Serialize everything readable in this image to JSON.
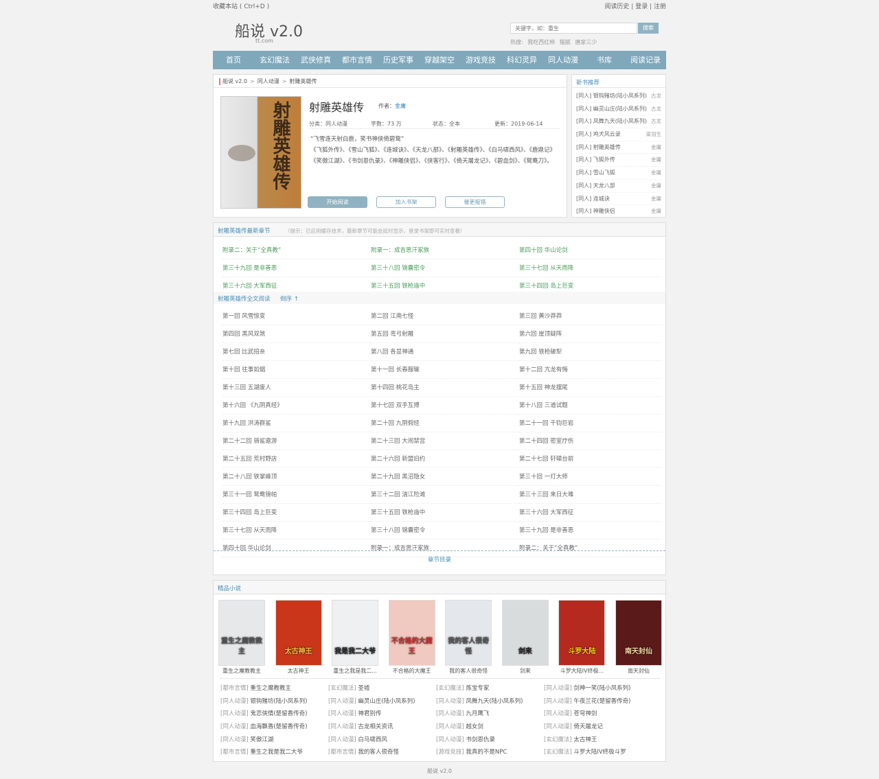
{
  "topbar": {
    "bookmark": "收藏本站 ( Ctrl+D )",
    "history": "阅读历史",
    "login": "登录",
    "register": "注册",
    "sep": " | "
  },
  "header": {
    "logo": "船说 v2.0",
    "logo_sub": "tt.com",
    "search_placeholder": "关键字，如：重生",
    "search_button": "搜索",
    "hot_label": "热搜:",
    "hot_items": [
      "我吃西红柿",
      "猫腻",
      "唐家三少"
    ]
  },
  "nav": [
    "首页",
    "玄幻魔法",
    "武侠修真",
    "都市言情",
    "历史军事",
    "穿越架空",
    "游戏竞技",
    "科幻灵异",
    "同人动漫",
    "书库",
    "阅读记录"
  ],
  "breadcrumb": [
    "船说 v2.0",
    ">",
    "同人动漫",
    ">",
    "射雕英雄传"
  ],
  "book": {
    "title": "射雕英雄传",
    "author_label": "作者：",
    "author": "金庸",
    "category": "分类：同人动漫",
    "words": "字数：73 万",
    "status": "状态：全本",
    "updated": "更新：2019-06-14",
    "desc": [
      "“飞雪连天射白鹿，笑书神侠倚碧鸳”",
      "《飞狐外传》、《雪山飞狐》、《连城诀》、《天龙八部》、《射雕英雄传》、《白马啸西风》、《鹿鼎记》",
      "《笑傲江湖》、《书剑恩仇录》、《神雕侠侣》、《侠客行》、《倚天屠龙记》、《碧血剑》、《鸳鸯刀》。"
    ],
    "btn_read": "开始阅读",
    "btn_shelf": "加入书架",
    "btn_vote": "催更报错",
    "cover_text": "射雕英雄传"
  },
  "recommend": {
    "title": "新书推荐",
    "items": [
      {
        "name": "[同人] 银钩赌坊(陆小凤系列)",
        "author": "古龙"
      },
      {
        "name": "[同人] 幽灵山庄(陆小凤系列)",
        "author": "古龙"
      },
      {
        "name": "[同人] 凤舞九天(陆小凤系列)",
        "author": "古龙"
      },
      {
        "name": "[同人] 鸡犬风云录",
        "author": "梁羽生"
      },
      {
        "name": "[同人] 射雕英雄传",
        "author": "金庸"
      },
      {
        "name": "[同人] 飞狐外传",
        "author": "金庸"
      },
      {
        "name": "[同人] 雪山飞狐",
        "author": "金庸"
      },
      {
        "name": "[同人] 天龙八部",
        "author": "金庸"
      },
      {
        "name": "[同人] 连城诀",
        "author": "金庸"
      },
      {
        "name": "[同人] 神雕侠侣",
        "author": "金庸"
      }
    ]
  },
  "latest": {
    "title": "射雕英雄传最新章节",
    "tip": "（提示：已启用缓存技术，最新章节可能会延时显示，登录书架即可实时查看）",
    "chapters": [
      "附录二：关于“全真教”",
      "附录一：成吉思汗家族",
      "第四十回 华山论剑",
      "第三十九回 是非善恶",
      "第三十八回 锦囊密令",
      "第三十七回 从天而降",
      "第三十六回 大军西征",
      "第三十五回 铁枪庙中",
      "第三十四回 岛上巨变"
    ]
  },
  "full": {
    "title": "射雕英雄传全文阅读",
    "order": "倒序 ↑",
    "chapters": [
      "第一回 风雪惊变",
      "第二回 江南七怪",
      "第三回 黄沙莽莽",
      "第四回 黑风双煞",
      "第五回 弯弓射雕",
      "第六回 崖顶疑阵",
      "第七回 比武招亲",
      "第八回 各显神通",
      "第九回 铁枪破犁",
      "第十回 往事如烟",
      "第十一回 长春服输",
      "第十二回 亢龙有悔",
      "第十三回 五湖废人",
      "第十四回 桃花岛主",
      "第十五回 神龙摆尾",
      "第十六回 《九阴真经》",
      "第十七回 双手互搏",
      "第十八回 三道试题",
      "第十九回 洪涛群鲨",
      "第二十回 九阴假经",
      "第二十一回 千钧巨岩",
      "第二十二回 骑鲨遨游",
      "第二十三回 大闹禁宫",
      "第二十四回 密室疗伤",
      "第二十五回 荒村野店",
      "第二十六回 新盟旧约",
      "第二十七回 轩辕台前",
      "第二十八回 铁掌峰顶",
      "第二十九回 黑沼隐女",
      "第三十回 一灯大师",
      "第三十一回 鸳鸯锦帕",
      "第三十二回 湍江险滩",
      "第三十三回 来日大难",
      "第三十四回 岛上巨变",
      "第三十五回 铁枪庙中",
      "第三十六回 大军西征",
      "第三十七回 从天而降",
      "第三十八回 锦囊密令",
      "第三十九回 是非善恶",
      "第四十回 华山论剑",
      "附录一：成吉思汗家族",
      "附录二：关于“全真教”"
    ],
    "dir_link": "章节目录"
  },
  "featured": {
    "title": "精品小说",
    "books": [
      {
        "name": "重生之魔教教主",
        "cover": "重生之魔教教主",
        "bg": "#e6e8ea",
        "fg": "#555"
      },
      {
        "name": "太古神王",
        "cover": "太古神王",
        "bg": "#c9361a",
        "fg": "#f5c542"
      },
      {
        "name": "重生之我是我二...",
        "cover": "我是我二大爷",
        "bg": "#eef0f2",
        "fg": "#222"
      },
      {
        "name": "不合格的大魔王",
        "cover": "不合格的大魔王",
        "bg": "#f0c9c0",
        "fg": "#c33"
      },
      {
        "name": "我的客人很奇怪",
        "cover": "我的客人很奇怪",
        "bg": "#e4e8ec",
        "fg": "#555"
      },
      {
        "name": "剑来",
        "cover": "剑来",
        "bg": "#d9dcdd",
        "fg": "#222"
      },
      {
        "name": "斗罗大陆IV终极...",
        "cover": "斗罗大陆",
        "bg": "#b52a1e",
        "fg": "#ffd400"
      },
      {
        "name": "南天封仙",
        "cover": "南天封仙",
        "bg": "#5a1a1a",
        "fg": "#f2d7a1"
      }
    ],
    "list": [
      {
        "c": "[都市言情]",
        "n": "重生之魔教教主"
      },
      {
        "c": "[玄幻魔法]",
        "n": "圣墟"
      },
      {
        "c": "[玄幻魔法]",
        "n": "炼宝专家"
      },
      {
        "c": "[同人动漫]",
        "n": "剑神一笑(陆小凤系列)"
      },
      {
        "c": "[同人动漫]",
        "n": "银钩赌坊(陆小凤系列)"
      },
      {
        "c": "[同人动漫]",
        "n": "幽灵山庄(陆小凤系列)"
      },
      {
        "c": "[同人动漫]",
        "n": "凤舞九天(陆小凤系列)"
      },
      {
        "c": "[同人动漫]",
        "n": "午夜兰花(楚留香传奇)"
      },
      {
        "c": "[同人动漫]",
        "n": "鬼恋侠情(楚留香传奇)"
      },
      {
        "c": "[同人动漫]",
        "n": "神君别传"
      },
      {
        "c": "[同人动漫]",
        "n": "九月鹰飞"
      },
      {
        "c": "[同人动漫]",
        "n": "苍穹神剑"
      },
      {
        "c": "[同人动漫]",
        "n": "血海飘香(楚留香传奇)"
      },
      {
        "c": "[同人动漫]",
        "n": "古龙相关资讯"
      },
      {
        "c": "[同人动漫]",
        "n": "越女剑"
      },
      {
        "c": "[同人动漫]",
        "n": "倚天屠龙记"
      },
      {
        "c": "[同人动漫]",
        "n": "笑傲江湖"
      },
      {
        "c": "[同人动漫]",
        "n": "白马啸西风"
      },
      {
        "c": "[同人动漫]",
        "n": "书剑恩仇录"
      },
      {
        "c": "[玄幻魔法]",
        "n": "太古神王"
      },
      {
        "c": "[都市言情]",
        "n": "重生之我是我二大爷"
      },
      {
        "c": "[都市言情]",
        "n": "我的客人很奇怪"
      },
      {
        "c": "[游戏竞技]",
        "n": "我真的不是NPC"
      },
      {
        "c": "[玄幻魔法]",
        "n": "斗罗大陆IV终极斗罗"
      }
    ]
  },
  "footer": "船说 v2.0"
}
